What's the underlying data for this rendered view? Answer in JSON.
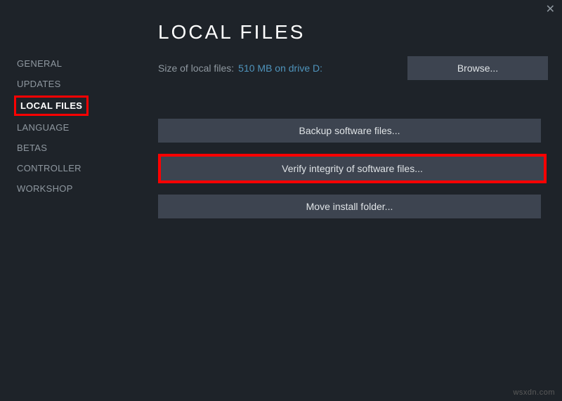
{
  "close_label": "✕",
  "sidebar": {
    "items": [
      {
        "label": "GENERAL"
      },
      {
        "label": "UPDATES"
      },
      {
        "label": "LOCAL FILES"
      },
      {
        "label": "LANGUAGE"
      },
      {
        "label": "BETAS"
      },
      {
        "label": "CONTROLLER"
      },
      {
        "label": "WORKSHOP"
      }
    ]
  },
  "main": {
    "title": "LOCAL FILES",
    "size_label": "Size of local files:",
    "size_value": "510 MB on drive D:",
    "browse_label": "Browse...",
    "buttons": {
      "backup": "Backup software files...",
      "verify": "Verify integrity of software files...",
      "move": "Move install folder..."
    }
  },
  "watermark": "wsxdn.com"
}
